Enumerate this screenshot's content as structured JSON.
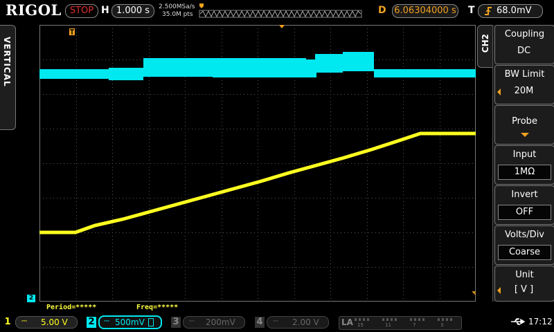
{
  "header": {
    "brand": "RIGOL",
    "run_state": "STOP",
    "h_label": "H",
    "timebase": "1.000 s",
    "sample_rate": "2.500MSa/s",
    "mem_depth": "35.0M pts",
    "d_label": "D",
    "delay": "6.06304000 s",
    "t_label": "T",
    "trigger_level": "68.0mV"
  },
  "left_tab": {
    "label": "VERTICAL"
  },
  "right_menu": {
    "channel_tab": "CH2",
    "items": [
      {
        "title": "Coupling",
        "value": "DC"
      },
      {
        "title": "BW Limit",
        "value": "20M"
      },
      {
        "title": "Probe",
        "value": ""
      },
      {
        "title": "Input",
        "value": "1MΩ"
      },
      {
        "title": "Invert",
        "value": "OFF"
      },
      {
        "title": "Volts/Div",
        "value": "Coarse"
      },
      {
        "title": "Unit",
        "value": "[ V ]"
      }
    ]
  },
  "measurements": {
    "period": "Period=*****",
    "freq": "Freq=*****"
  },
  "markers": {
    "ch2_ground": "2"
  },
  "channels": [
    {
      "num": "1",
      "value": "5.00 V",
      "color": "#ffff20",
      "active": true
    },
    {
      "num": "2",
      "value": "500mV",
      "color": "#00e0ff",
      "active": true
    },
    {
      "num": "3",
      "value": "200mV",
      "color": "#555555",
      "active": false
    },
    {
      "num": "4",
      "value": "2.00 V",
      "color": "#555555",
      "active": false
    }
  ],
  "la": {
    "label": "LA",
    "digits": [
      "15",
      "11",
      "7",
      "3"
    ]
  },
  "status": {
    "time": "17:12"
  },
  "colors": {
    "ch1": "#ffff20",
    "ch2": "#00e8f0",
    "accent": "#f0a020",
    "grid": "#5a5a5a"
  }
}
